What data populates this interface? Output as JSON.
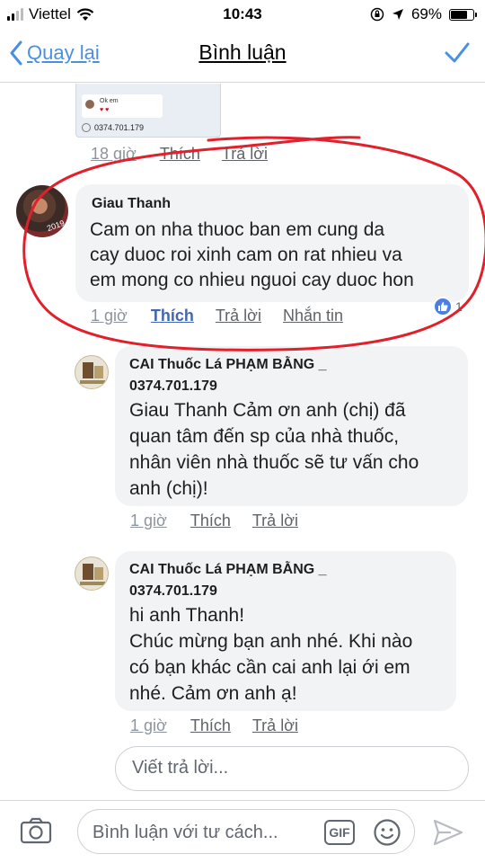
{
  "status_bar": {
    "carrier": "Viettel",
    "time": "10:43",
    "battery_text": "69%",
    "battery_level": 0.69
  },
  "nav": {
    "back_label": "Quay lại",
    "title": "Bình luận"
  },
  "previous_comment": {
    "thumbnail": {
      "message": "Ok em",
      "phone": "0374.701.179"
    },
    "time": "18 giờ",
    "like_label": "Thích",
    "reply_label": "Trả lời"
  },
  "comments": [
    {
      "author": "Giau Thanh",
      "lines": [
        "Cam on nha thuoc ban em cung da",
        "cay duoc roi xinh cam on rat nhieu va",
        "em mong co nhieu nguoi cay duoc hon"
      ],
      "time": "1 giờ",
      "like_label": "Thích",
      "reply_label": "Trả lời",
      "message_label": "Nhắn tin",
      "like_count": "1"
    },
    {
      "author_lines": [
        "CAI Thuốc Lá PHẠM BẰNG _",
        "0374.701.179"
      ],
      "lines": [
        "Giau Thanh Cảm ơn anh (chị) đã",
        "quan tâm đến sp của nhà thuốc,",
        "nhân viên nhà thuốc sẽ tư vấn cho",
        "anh (chị)!"
      ],
      "time": "1 giờ",
      "like_label": "Thích",
      "reply_label": "Trả lời"
    },
    {
      "author_lines": [
        "CAI Thuốc Lá PHẠM BẰNG _",
        "0374.701.179"
      ],
      "lines": [
        "hi anh Thanh!",
        "Chúc mừng bạn anh nhé. Khi nào",
        "có bạn khác cần cai anh lại ới em",
        "nhé. Cảm ơn anh ạ!"
      ],
      "time": "1 giờ",
      "like_label": "Thích",
      "reply_label": "Trả lời"
    }
  ],
  "reply_box": {
    "placeholder": "Viết trả lời..."
  },
  "composer": {
    "placeholder": "Bình luận với tư cách...",
    "gif_label": "GIF"
  },
  "colors": {
    "accent": "#4a90e2",
    "annotation": "#e0202a",
    "bubble": "#f2f3f5",
    "like_blue": "#4a7fe3"
  },
  "icons": [
    "signal-icon",
    "wifi-icon",
    "lock-rotation-icon",
    "location-icon",
    "battery-icon",
    "back-chevron-icon",
    "checkmark-icon",
    "thumbs-up-icon",
    "camera-icon",
    "emoji-icon",
    "send-icon"
  ]
}
